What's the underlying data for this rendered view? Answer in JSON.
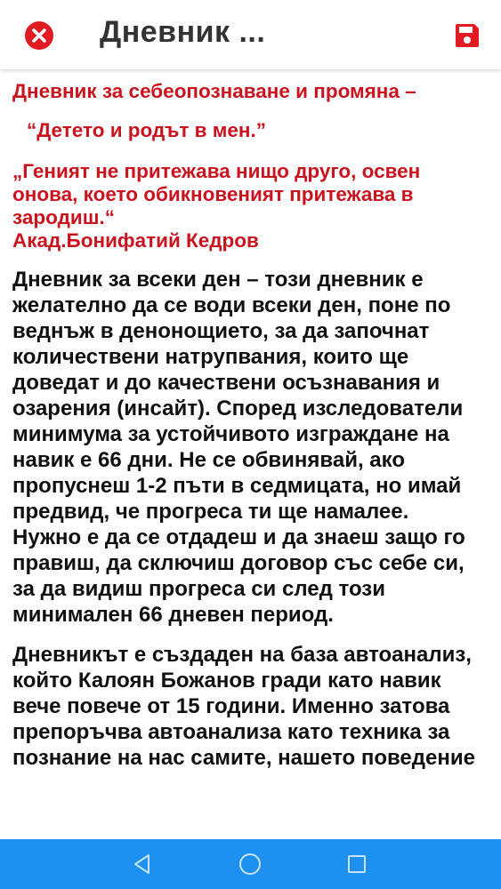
{
  "toolbar": {
    "title": "Дневник ...",
    "close_icon": "close-circle-icon",
    "save_icon": "floppy-disk-icon"
  },
  "content": {
    "heading_line1": "Дневник за себеопознаване и промяна –",
    "heading_line2": "“Детето и родът в мен.”",
    "quote": "„Геният не притежава нищо друго, освен онова, което обикновеният притежава в зародиш.“",
    "author": "Акад.Бонифатий Кедров",
    "paragraph_1": "Дневник за всеки ден – този дневник е желателно да се води всеки ден, поне по веднъж в денонощието, за да започнат количествени натрупвания, които ще доведат и до качествени осъзнавания и озарения (инсайт). Според изследователи минимума за устойчивото изграждане на навик е 66 дни.  Не се обвинявай, ако пропуснеш 1-2 пъти в седмицата, но имай предвид, че прогреса ти ще намалее. Нужно е да се отдадеш и да знаеш защо го правиш, да сключиш договор със себе си, за да видиш прогреса си след този минимален 66 дневен период.",
    "paragraph_2": "Дневникът е създаден на база автоанализ, който Калоян Божанов гради като навик вече повече от 15 години. Именно затова препоръчва автоанализа като техника за познание на нас самите, нашето поведение"
  },
  "navbar": {
    "back_icon": "back-triangle-icon",
    "home_icon": "home-circle-icon",
    "recents_icon": "recents-square-icon"
  },
  "colors": {
    "accent_red": "#c8141f",
    "navbar_blue": "#1e90f0",
    "text_dark": "#111111"
  }
}
